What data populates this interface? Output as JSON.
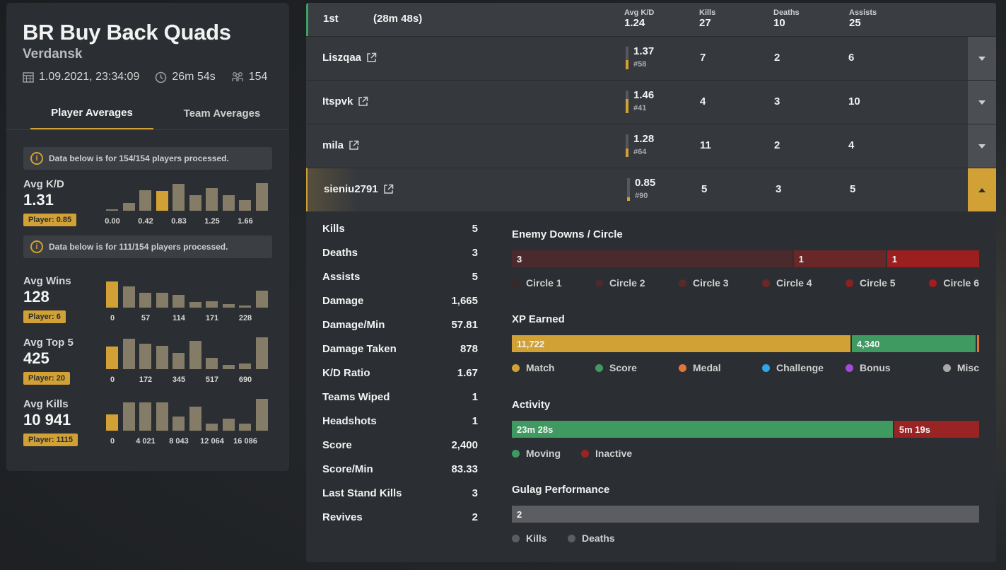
{
  "match": {
    "title": "BR Buy Back Quads",
    "map": "Verdansk",
    "datetime": "1.09.2021, 23:34:09",
    "duration": "26m 54s",
    "players": "154"
  },
  "left_tabs": [
    "Player Averages",
    "Team Averages"
  ],
  "notices": {
    "first": "Data below is for 154/154 players processed.",
    "second": "Data below is for 111/154 players processed."
  },
  "averages": [
    {
      "label": "Avg K/D",
      "value": "1.31",
      "player": "Player: 0.85",
      "bars": [
        0.04,
        0.24,
        0.62,
        0.6,
        0.82,
        0.47,
        0.7,
        0.47,
        0.32,
        0.84
      ],
      "highlight": 3,
      "ticks": [
        "0.00",
        "0.42",
        "0.83",
        "1.25",
        "1.66"
      ]
    },
    {
      "label": "Avg Wins",
      "value": "128",
      "player": "Player: 6",
      "bars": [
        0.8,
        0.66,
        0.46,
        0.46,
        0.39,
        0.17,
        0.2,
        0.1,
        0.07,
        0.53
      ],
      "highlight": 0,
      "ticks": [
        "0",
        "57",
        "114",
        "171",
        "228"
      ]
    },
    {
      "label": "Avg Top 5",
      "value": "425",
      "player": "Player: 20",
      "bars": [
        0.7,
        0.93,
        0.78,
        0.72,
        0.5,
        0.88,
        0.35,
        0.12,
        0.17,
        0.98
      ],
      "highlight": 0,
      "ticks": [
        "0",
        "172",
        "345",
        "517",
        "690"
      ]
    },
    {
      "label": "Avg Kills",
      "value": "10 941",
      "player": "Player: 1115",
      "bars": [
        0.5,
        0.88,
        0.88,
        0.87,
        0.43,
        0.73,
        0.21,
        0.38,
        0.21,
        0.98
      ],
      "highlight": 0,
      "ticks": [
        "0",
        "4 021",
        "8 043",
        "12 064",
        "16 086"
      ]
    }
  ],
  "team": {
    "place": "1st",
    "time": "(28m 48s)",
    "headers": {
      "kd": "Avg K/D",
      "kills": "Kills",
      "deaths": "Deaths",
      "assists": "Assists"
    },
    "kd": "1.24",
    "kills": "27",
    "deaths": "10",
    "assists": "25"
  },
  "players": [
    {
      "name": "Liszqaa",
      "kd": "1.37",
      "rank": "#58",
      "kd_fill": 0.42,
      "kills": "7",
      "deaths": "2",
      "assists": "6",
      "open": false
    },
    {
      "name": "Itspvk",
      "kd": "1.46",
      "rank": "#41",
      "kd_fill": 0.62,
      "kills": "4",
      "deaths": "3",
      "assists": "10",
      "open": false
    },
    {
      "name": "mila",
      "kd": "1.28",
      "rank": "#64",
      "kd_fill": 0.38,
      "kills": "11",
      "deaths": "2",
      "assists": "4",
      "open": false
    },
    {
      "name": "sieniu2791",
      "kd": "0.85",
      "rank": "#90",
      "kd_fill": 0.16,
      "kills": "5",
      "deaths": "3",
      "assists": "5",
      "open": true
    }
  ],
  "detail_stats": [
    {
      "label": "Kills",
      "value": "5"
    },
    {
      "label": "Deaths",
      "value": "3"
    },
    {
      "label": "Assists",
      "value": "5"
    },
    {
      "label": "Damage",
      "value": "1,665"
    },
    {
      "label": "Damage/Min",
      "value": "57.81"
    },
    {
      "label": "Damage Taken",
      "value": "878"
    },
    {
      "label": "K/D Ratio",
      "value": "1.67"
    },
    {
      "label": "Teams Wiped",
      "value": "1"
    },
    {
      "label": "Headshots",
      "value": "1"
    },
    {
      "label": "Score",
      "value": "2,400"
    },
    {
      "label": "Score/Min",
      "value": "83.33"
    },
    {
      "label": "Last Stand Kills",
      "value": "3"
    },
    {
      "label": "Revives",
      "value": "2"
    }
  ],
  "enemy_downs": {
    "title": "Enemy Downs / Circle",
    "segments": [
      {
        "label": "3",
        "value": 3,
        "color": "#4a2a2c"
      },
      {
        "label": "1",
        "value": 1,
        "color": "#6a2727"
      },
      {
        "label": "1",
        "value": 1,
        "color": "#9b1f1f"
      }
    ],
    "legend": [
      {
        "label": "Circle 1",
        "color": "#3a2729"
      },
      {
        "label": "Circle 2",
        "color": "#4a2a2c"
      },
      {
        "label": "Circle 3",
        "color": "#5a2a2b"
      },
      {
        "label": "Circle 4",
        "color": "#6a2727"
      },
      {
        "label": "Circle 5",
        "color": "#8a2222"
      },
      {
        "label": "Circle 6",
        "color": "#a61d1d"
      }
    ]
  },
  "xp": {
    "title": "XP Earned",
    "segments": [
      {
        "label": "11,722",
        "value": 11722,
        "color": "#d1a136"
      },
      {
        "label": "4,340",
        "value": 4340,
        "color": "#3f9a62"
      },
      {
        "label": "",
        "value": 120,
        "color": "#e0753a"
      }
    ],
    "legend": [
      {
        "label": "Match",
        "color": "#d1a136"
      },
      {
        "label": "Score",
        "color": "#3f9a62"
      },
      {
        "label": "Medal",
        "color": "#e0753a"
      },
      {
        "label": "Challenge",
        "color": "#2ea6e8"
      },
      {
        "label": "Bonus",
        "color": "#a54ad8"
      },
      {
        "label": "Misc",
        "color": "#a8a8a8"
      }
    ]
  },
  "activity": {
    "title": "Activity",
    "segments": [
      {
        "label": "23m 28s",
        "value": 1408,
        "color": "#3f9a62"
      },
      {
        "label": "5m 19s",
        "value": 319,
        "color": "#9a2424"
      }
    ],
    "legend": [
      {
        "label": "Moving",
        "color": "#3f9a62"
      },
      {
        "label": "Inactive",
        "color": "#9a2424"
      }
    ]
  },
  "gulag": {
    "title": "Gulag Performance",
    "segments": [
      {
        "label": "2",
        "value": 1,
        "color": "#5b5d60"
      }
    ],
    "legend": [
      {
        "label": "Kills",
        "color": "#5b5d60"
      },
      {
        "label": "Deaths",
        "color": "#5b5d60"
      }
    ]
  }
}
